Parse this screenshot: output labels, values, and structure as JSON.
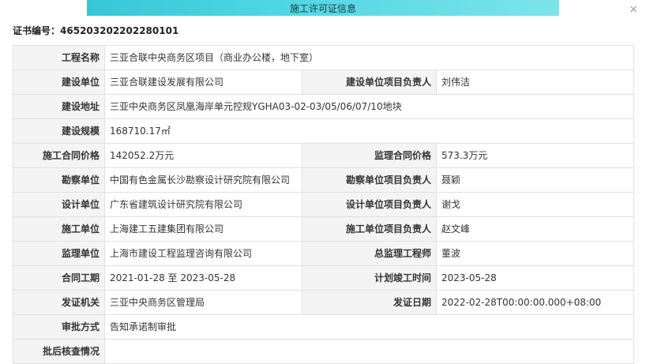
{
  "dialog": {
    "title": "施工许可证信息",
    "close_symbol": "×"
  },
  "certificate": {
    "label": "证书编号：",
    "number": "465203202202280101"
  },
  "rows": [
    {
      "cells": [
        {
          "label": "工程名称",
          "value": "三亚合联中央商务区项目（商业办公楼，地下室）"
        }
      ]
    },
    {
      "cells": [
        {
          "label": "建设单位",
          "value": "三亚合联建设发展有限公司"
        },
        {
          "label": "建设单位项目负责人",
          "value": "刘伟洁"
        }
      ]
    },
    {
      "cells": [
        {
          "label": "建设地址",
          "value": "三亚中央商务区凤凰海岸单元控规YGHA03-02-03/05/06/07/10地块"
        }
      ]
    },
    {
      "cells": [
        {
          "label": "建设规模",
          "value": "168710.17㎡"
        }
      ]
    },
    {
      "cells": [
        {
          "label": "施工合同价格",
          "value": "142052.2万元"
        },
        {
          "label": "监理合同价格",
          "value": "573.3万元"
        }
      ]
    },
    {
      "cells": [
        {
          "label": "勘察单位",
          "value": "中国有色金属长沙勘察设计研究院有限公司"
        },
        {
          "label": "勘察单位项目负责人",
          "value": "聂颖"
        }
      ]
    },
    {
      "cells": [
        {
          "label": "设计单位",
          "value": "广东省建筑设计研究院有限公司"
        },
        {
          "label": "设计单位项目负责人",
          "value": "谢戈"
        }
      ]
    },
    {
      "cells": [
        {
          "label": "施工单位",
          "value": "上海建工五建集团有限公司"
        },
        {
          "label": "施工单位项目负责人",
          "value": "赵文峰"
        }
      ]
    },
    {
      "cells": [
        {
          "label": "监理单位",
          "value": "上海市建设工程监理咨询有限公司"
        },
        {
          "label": "总监理工程师",
          "value": "董波"
        }
      ]
    },
    {
      "cells": [
        {
          "label": "合同工期",
          "value": "2021-01-28 至 2023-05-28"
        },
        {
          "label": "计划竣工时间",
          "value": "2023-05-28"
        }
      ]
    },
    {
      "cells": [
        {
          "label": "发证机关",
          "value": "三亚中央商务区管理局"
        },
        {
          "label": "发证日期",
          "value": "2022-02-28T00:00:00.000+08:00"
        }
      ]
    },
    {
      "cells": [
        {
          "label": "审批方式",
          "value": "告知承诺制审批"
        }
      ]
    },
    {
      "cells": [
        {
          "label": "批后核查情况",
          "value": ""
        }
      ]
    }
  ],
  "colors": {
    "banner": "#4fd6e2",
    "label_bg": "#f4f4f4",
    "border": "#e1e1e1"
  }
}
